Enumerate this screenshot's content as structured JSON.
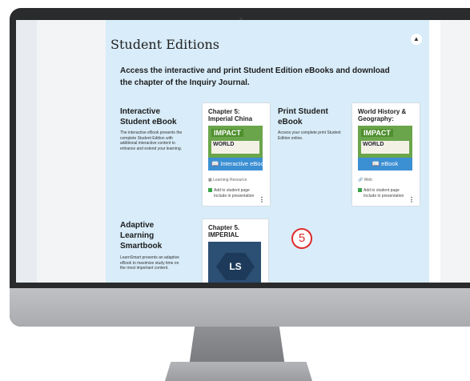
{
  "section": {
    "title": "Student Editions",
    "collapse_icon": "chevron-up-icon",
    "intro": "Access the interactive and print Student Edition eBooks and download the chapter of the Inquiry Journal."
  },
  "interactive": {
    "title": "Interactive Student eBook",
    "description": "The interactive eBook presents the complete Student Edition with additional interactive content to enhance and extend your learning.",
    "card": {
      "title": "Chapter 5: Imperial China",
      "cover_brand": "IMPACT",
      "cover_book": "WORLD",
      "cover_button": "Interactive eBook",
      "tag": "Learning Resource",
      "add_label": "Add to student page",
      "include_label": "Include in presentation"
    }
  },
  "print": {
    "title": "Print Student eBook",
    "description": "Access your complete print Student Edition online.",
    "card": {
      "title": "World History & Geography:",
      "cover_brand": "IMPACT",
      "cover_book": "WORLD",
      "cover_button": "eBook",
      "tag": "Web",
      "add_label": "Add to student page",
      "include_label": "Include in presentation"
    }
  },
  "adaptive": {
    "title": "Adaptive Learning Smartbook",
    "description": "LearnSmart presents an adaptive eBook to maximize study time on the most important content.",
    "card": {
      "title": "Chapter 5. IMPERIAL",
      "logo_text": "LS"
    }
  },
  "callout": {
    "number": "5"
  },
  "colors": {
    "panel": "#d8ecf9",
    "accent": "#3b8fd3",
    "callout": "#e02a2a",
    "check": "#3aa54a"
  }
}
